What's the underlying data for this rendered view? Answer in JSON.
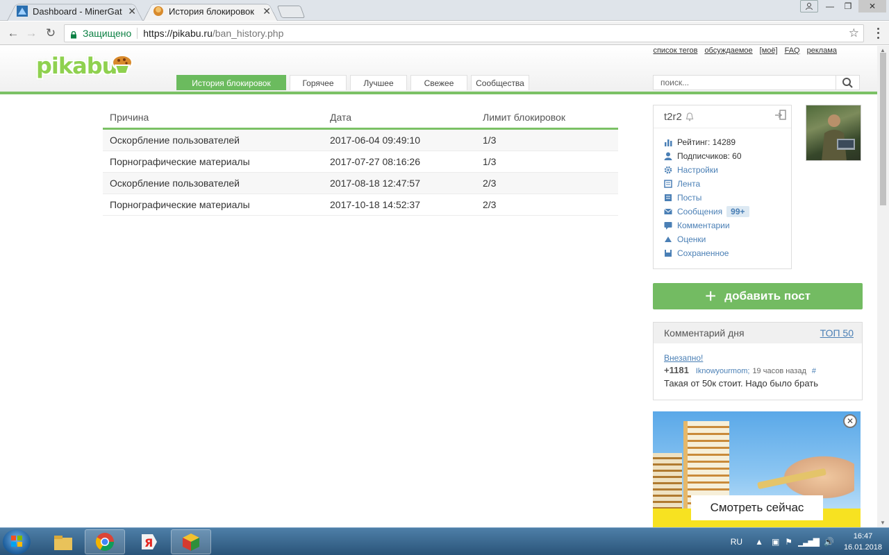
{
  "browser": {
    "tabs": [
      {
        "title": "Dashboard - MinerGate.c",
        "active": false
      },
      {
        "title": "История блокировок",
        "active": true
      }
    ],
    "secure_label": "Защищено",
    "url_host": "https://pikabu.ru",
    "url_path": "/ban_history.php"
  },
  "site": {
    "logo": "pikabu",
    "top_links": [
      "список тегов",
      "обсуждаемое",
      "[моё]",
      "FAQ",
      "реклама"
    ],
    "nav_tabs": [
      "История блокировок",
      "Горячее",
      "Лучшее",
      "Свежее",
      "Сообщества"
    ],
    "search_placeholder": "поиск..."
  },
  "ban_table": {
    "headers": [
      "Причина",
      "Дата",
      "Лимит блокировок"
    ],
    "rows": [
      [
        "Оскорбление пользователей",
        "2017-06-04 09:49:10",
        "1/3"
      ],
      [
        "Порнографические материалы",
        "2017-07-27 08:16:26",
        "1/3"
      ],
      [
        "Оскорбление пользователей",
        "2017-08-18 12:47:57",
        "2/3"
      ],
      [
        "Порнографические материалы",
        "2017-10-18 14:52:37",
        "2/3"
      ]
    ]
  },
  "profile": {
    "username": "t2r2",
    "rating": "Рейтинг: 14289",
    "subscribers": "Подписчиков: 60",
    "menu": [
      "Настройки",
      "Лента",
      "Посты",
      "Сообщения",
      "Комментарии",
      "Оценки",
      "Сохраненное"
    ],
    "messages_badge": "99+"
  },
  "add_post": "добавить пост",
  "comment_of_day": {
    "heading": "Комментарий дня",
    "top_link": "ТОП 50",
    "post_title": "Внезапно!",
    "rating": "+1181",
    "user": "Iknowyourmom;",
    "time": "19 часов назад",
    "hash": "#",
    "text": "Такая от 50к стоит. Надо было брать"
  },
  "ad": {
    "cta": "Смотреть сейчас"
  },
  "taskbar": {
    "lang": "RU",
    "time": "16:47",
    "date": "16.01.2018"
  },
  "colors": {
    "brand_green": "#7bc165",
    "link_blue": "#4a7fb5"
  }
}
